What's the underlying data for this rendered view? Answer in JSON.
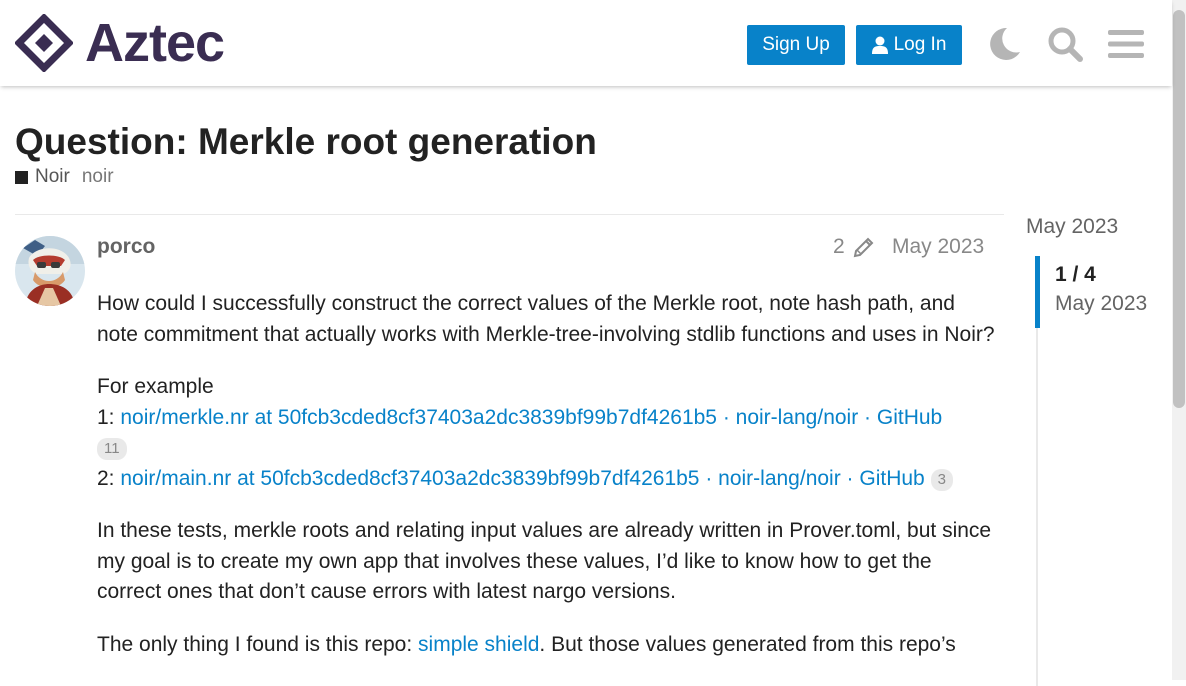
{
  "header": {
    "logo_text": "Aztec",
    "signup_label": "Sign Up",
    "login_label": "Log In",
    "icons": [
      "moon-icon",
      "search-icon",
      "hamburger-menu-icon"
    ]
  },
  "topic": {
    "title": "Question: Merkle root generation",
    "category": "Noir",
    "tag": "noir"
  },
  "post": {
    "username": "porco",
    "edit_count": "2",
    "date": "May 2023",
    "paragraph1": "How could I successfully construct the correct values of the Merkle root, note hash path, and note commitment that actually works with Merkle-tree-involving stdlib functions and uses in Noir?",
    "example_label": "For example",
    "link1_prefix": "1: ",
    "link1_text": "noir/merkle.nr at 50fcb3cded8cf37403a2dc3839bf99b7df4261b5 · noir-lang/noir · GitHub",
    "link1_clicks": "11",
    "link2_prefix": "2: ",
    "link2_text": "noir/main.nr at 50fcb3cded8cf37403a2dc3839bf99b7df4261b5 · noir-lang/noir · GitHub",
    "link2_clicks": "3",
    "paragraph3": "In these tests, merkle roots and relating input values are already written in Prover.toml, but since my goal is to create my own app that involves these values, I’d like to know how to get the correct ones that don’t cause errors with latest nargo versions.",
    "paragraph4_prefix": "The only thing I found is this repo: ",
    "paragraph4_link": "simple shield",
    "paragraph4_suffix": ". But those values generated from this repo’s"
  },
  "timeline": {
    "top_date": "May 2023",
    "position": "1 / 4",
    "current_date": "May 2023"
  },
  "colors": {
    "accent": "#0882c9",
    "logo": "#3a2d52",
    "muted": "#888888"
  }
}
